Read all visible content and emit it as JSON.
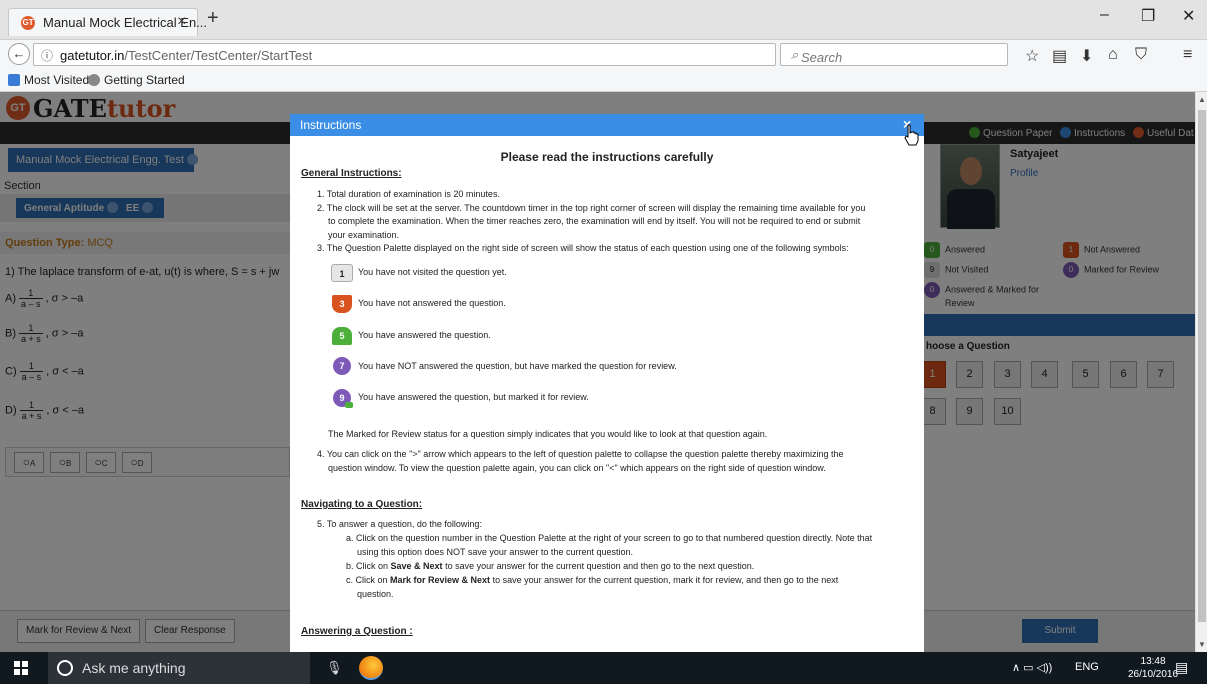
{
  "browser": {
    "tab_title": "Manual Mock Electrical En...",
    "tab_close": "×",
    "new_tab": "+",
    "win_minimize": "–",
    "win_restore": "❐",
    "win_close": "✕",
    "url_host": "gatetutor.in",
    "url_path": "/TestCenter/TestCenter/StartTest",
    "search_placeholder": "Search",
    "bookmarks": [
      "Most Visited",
      "Getting Started"
    ]
  },
  "page": {
    "logo_gate": "GATE",
    "logo_tutor": "tutor",
    "logo_badge": "GT",
    "top_links": [
      "Question Paper",
      "Instructions",
      "Useful Dat"
    ],
    "test_name": "Manual Mock Electrical Engg. Test",
    "section_label": "Section",
    "section_tabs": [
      "General Aptitude",
      "EE"
    ],
    "question_type_label": "Question Type:",
    "question_type": "MCQ",
    "question": "1) The laplace transform of e-at, u(t) is where,  S = s + jw",
    "options": [
      {
        "label": "A)",
        "num": "1",
        "den": "a – s",
        "cond": ",  σ > –a"
      },
      {
        "label": "B)",
        "num": "1",
        "den": "a + s",
        "cond": ",  σ > –a"
      },
      {
        "label": "C)",
        "num": "1",
        "den": "a – s",
        "cond": ",  σ < –a"
      },
      {
        "label": "D)",
        "num": "1",
        "den": "a + s",
        "cond": ",  σ < –a"
      }
    ],
    "choices": [
      "A",
      "B",
      "C",
      "D"
    ],
    "mark_review_button": "Mark for Review & Next",
    "clear_response_button": "Clear Response",
    "submit_button": "Submit",
    "user_name": "Satyajeet",
    "profile_link": "Profile",
    "legend": {
      "answered": "Answered",
      "not_answered": "Not Answered",
      "not_visited": "Not Visited",
      "marked_review": "Marked for Review",
      "answered_marked_1": "Answered & Marked for",
      "answered_marked_2": "Review",
      "count_answered": "0",
      "count_not_answered": "1",
      "count_not_visited": "9",
      "count_marked": "0",
      "count_answered_marked": "0"
    },
    "choose_question": "hoose a Question",
    "palette": [
      "1",
      "2",
      "3",
      "4",
      "5",
      "6",
      "7",
      "8",
      "9",
      "10"
    ]
  },
  "modal": {
    "header": "Instructions",
    "close": "×",
    "title": "Please read the instructions carefully",
    "general_heading": "General Instructions:",
    "general_lines": [
      "1. Total duration of examination is 20 minutes.",
      "2. The clock will be set at the server. The countdown timer in the top right corner of screen will display the remaining time available for you",
      "to complete the examination. When the timer reaches zero, the examination will end by itself. You will not be required to end or submit",
      "your examination.",
      "3. The Question Palette displayed on the right side of screen will show the status of each question using one of the following symbols:"
    ],
    "symbols": [
      {
        "num": "1",
        "text": "You have not visited the question yet."
      },
      {
        "num": "3",
        "text": "You have not answered the question."
      },
      {
        "num": "5",
        "text": "You have answered the question."
      },
      {
        "num": "7",
        "text": "You have NOT answered the question, but have marked the question for review."
      },
      {
        "num": "9",
        "text": "You have answered the question, but marked it for review."
      }
    ],
    "marked_note": "The Marked for Review status for a question simply indicates that you would like to look at that question again.",
    "point4_a": "4. You can click on the \">\" arrow which appears to the left of question palette to collapse the question palette thereby maximizing the",
    "point4_b": "question window. To view the question palette again, you can click on \"<\" which appears on the right side of question window.",
    "nav_heading": "Navigating to a Question:",
    "point5": "5. To answer a question, do the following:",
    "point5a_1": "a. Click on the question number in the Question Palette at the right of your screen to go to that numbered question directly. Note that",
    "point5a_2": "using this option does NOT save your answer to the current question.",
    "point5b_pre": "b. Click on ",
    "point5b_bold": "Save & Next",
    "point5b_post": " to save your answer for the current question and then go to the next question.",
    "point5c_pre": "c. Click on ",
    "point5c_bold": "Mark for Review & Next",
    "point5c_post": " to save your answer for the current question, mark it for review, and then go to the next",
    "point5c_2": "question.",
    "answer_heading": "Answering a Question :"
  },
  "taskbar": {
    "search": "Ask me anything",
    "lang": "ENG",
    "time": "13:48",
    "date": "26/10/2016"
  },
  "colors": {
    "accent_blue": "#2f6fb6",
    "modal_header": "#3b8ee6",
    "not_answered": "#d9531e",
    "answered": "#4caf3a",
    "marked": "#7d5ab7"
  }
}
